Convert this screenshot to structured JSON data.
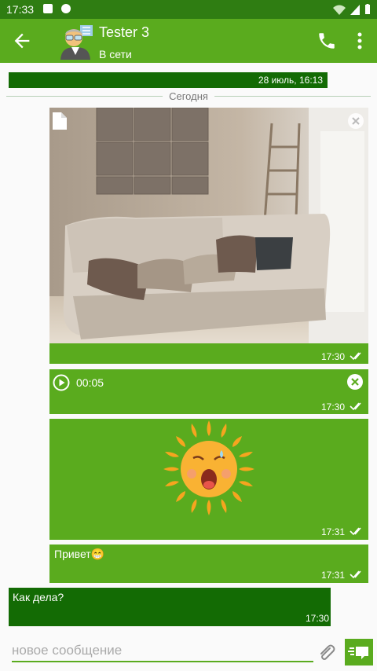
{
  "status_bar": {
    "time": "17:33"
  },
  "app_bar": {
    "title": "Tester 3",
    "subtitle": "В сети"
  },
  "banner": {
    "text": "28 июль, 16:13"
  },
  "divider": {
    "label": "Сегодня"
  },
  "messages": {
    "photo": {
      "time": "17:30"
    },
    "audio": {
      "duration": "00:05",
      "time": "17:30"
    },
    "sticker": {
      "time": "17:31"
    },
    "text": {
      "body": "Привет😁",
      "time": "17:31"
    },
    "incoming": {
      "body": "Как дела?",
      "time": "17:30"
    }
  },
  "composer": {
    "placeholder": "новое сообщение"
  },
  "colors": {
    "primary": "#5aab1e",
    "dark": "#136b04",
    "statusbar": "#2f7d12"
  },
  "icons": [
    "back-arrow-icon",
    "phone-icon",
    "more-vert-icon",
    "file-icon",
    "close-icon",
    "play-icon",
    "double-check-icon",
    "attach-icon",
    "send-icon"
  ]
}
